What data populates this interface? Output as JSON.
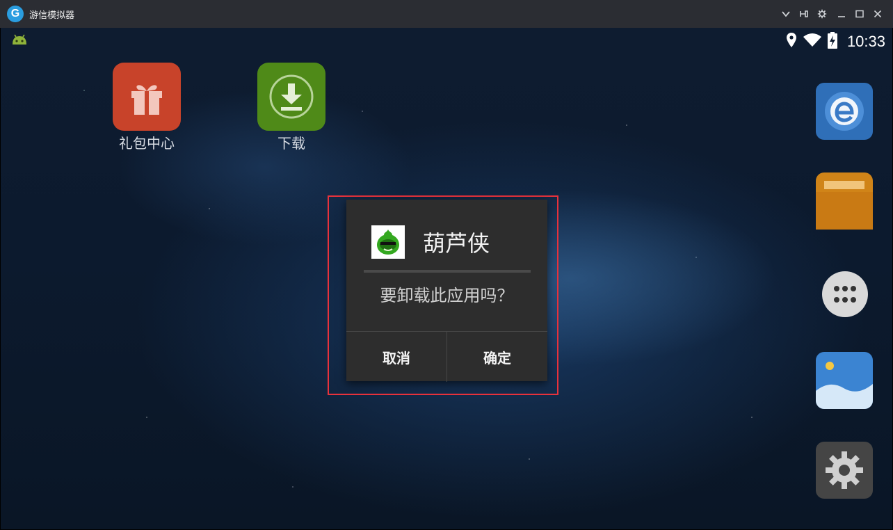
{
  "window": {
    "title": "游信模拟器",
    "logo_letter": "G"
  },
  "status_bar": {
    "time": "10:33"
  },
  "desktop_apps": [
    {
      "label": "礼包中心",
      "color": "#d44a2c",
      "icon": "gift-icon"
    },
    {
      "label": "下载",
      "color": "#5a9a1e",
      "icon": "download-icon"
    }
  ],
  "dock": [
    {
      "name": "browser",
      "icon": "browser-e-icon",
      "color": "#2e76c8"
    },
    {
      "name": "files",
      "icon": "folder-icon",
      "color": "#d48a1e"
    },
    {
      "name": "all-apps",
      "icon": "app-drawer-icon",
      "color": "#d9d9d9"
    },
    {
      "name": "gallery",
      "icon": "gallery-icon",
      "color": "#3f8bd8"
    },
    {
      "name": "settings",
      "icon": "gear-icon",
      "color": "#4b4b4b"
    }
  ],
  "dialog": {
    "app_name": "葫芦侠",
    "message": "要卸载此应用吗？",
    "cancel_label": "取消",
    "ok_label": "确定"
  },
  "colors": {
    "highlight": "#e8323c",
    "dialog_bg": "#2d2d2d"
  }
}
